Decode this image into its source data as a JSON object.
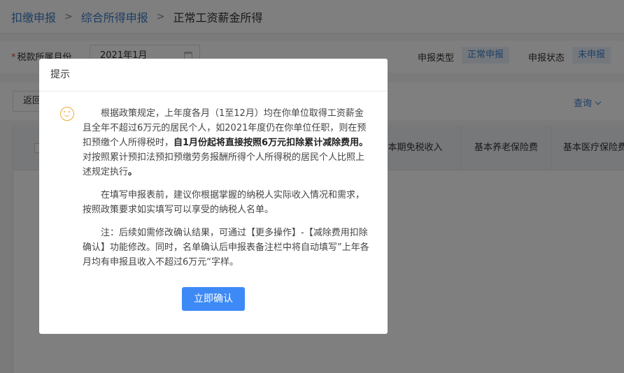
{
  "breadcrumb": {
    "items": [
      "扣缴申报",
      "综合所得申报"
    ],
    "current": "正常工资薪金所得"
  },
  "filter": {
    "period_label": "税款所属月份",
    "period_value": "2021年1月",
    "type_label": "申报类型",
    "type_value": "正常申报",
    "status_label": "申报状态",
    "status_value": "未申报"
  },
  "toolbar": {
    "back_label": "返回",
    "query_label": "查询"
  },
  "table": {
    "columns": [
      "本期免税收入",
      "基本养老保险费",
      "基本医疗保险费"
    ]
  },
  "modal": {
    "title": "提示",
    "p1_a": "根据政策规定，上年度各月（1至12月）均在你单位取得工资薪金且全年不超过6万元的居民个人，如2021年度仍在你单位任职，则在预扣预缴个人所得税时，",
    "p1_bold1": "自1月份起将直接按照6万元扣除累计减除费用。",
    "p1_b": "对按照累计预扣法预扣预缴劳务报酬所得个人所得税的居民个人比照上述规定执行",
    "p1_bold2": "。",
    "p2": "在填写申报表前，建议你根据掌握的纳税人实际收入情况和需求，按照政策要求如实填写可以享受的纳税人名单。",
    "p3": "注：后续如需修改确认结果，可通过【更多操作】-【减除费用扣除确认】功能修改。同时，名单确认后申报表备注栏中将自动填写”上年各月均有申报且收入不超过6万元“字样。",
    "confirm_label": "立即确认"
  }
}
